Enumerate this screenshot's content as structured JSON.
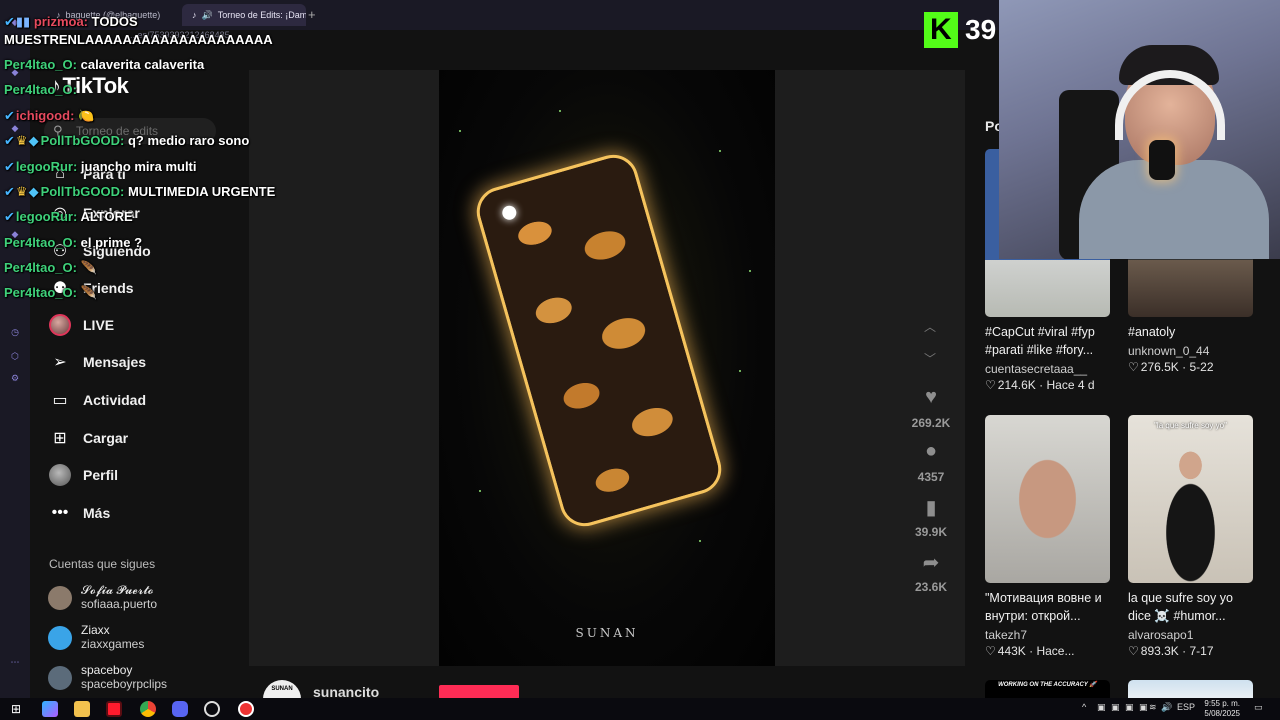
{
  "browser": {
    "tabs": [
      {
        "label": "baguette (@elbaguette)"
      },
      {
        "label": "Torneo de Edits: ¡Dam"
      }
    ],
    "new_tab": "+",
    "url_fragment": "...es/7539393212468485"
  },
  "chat": [
    {
      "user": "prizmoa:",
      "user_color": "#e64a5f",
      "message": "TODOS",
      "badges": "check-bars"
    },
    {
      "user": "",
      "user_color": "#ffffff",
      "message": "MUESTRENLAAAAAAAAAAAAAAAAAAAA",
      "badges": ""
    },
    {
      "user": "Per4ltao_O:",
      "user_color": "#3fd17a",
      "message": "calaverita calaverita",
      "badges": ""
    },
    {
      "user": "Per4ltao_O:",
      "user_color": "#3fd17a",
      "message": "",
      "badges": ""
    },
    {
      "user": "ichigood:",
      "user_color": "#e64a5f",
      "message": "",
      "emote": "🍋",
      "badges": "check"
    },
    {
      "user": "PollTbGOOD:",
      "user_color": "#3fd17a",
      "message": "q? medio raro sono",
      "badges": "check-crown-gem"
    },
    {
      "user": "legooRur:",
      "user_color": "#3fd17a",
      "message": "juancho mira multi",
      "badges": "check"
    },
    {
      "user": "PollTbGOOD:",
      "user_color": "#3fd17a",
      "message": "MULTIMEDIA URGENTE",
      "badges": "check-crown-gem"
    },
    {
      "user": "legooRur:",
      "user_color": "#3fd17a",
      "message": "ALTORE",
      "badges": "check"
    },
    {
      "user": "Per4ltao_O:",
      "user_color": "#3fd17a",
      "message": "el prime ?",
      "badges": ""
    },
    {
      "user": "Per4ltao_O:",
      "user_color": "#3fd17a",
      "message": "",
      "emote": "🪶",
      "badges": ""
    },
    {
      "user": "Per4ltao_O:",
      "user_color": "#3fd17a",
      "message": "",
      "emote": "🪶",
      "badges": ""
    }
  ],
  "tiktok": {
    "logo": "TikTok",
    "search_placeholder": "Torneo de edits",
    "nav": [
      {
        "label": "Para ti",
        "icon": "home-icon"
      },
      {
        "label": "Explorar",
        "icon": "compass-icon"
      },
      {
        "label": "Siguiendo",
        "icon": "following-icon"
      },
      {
        "label": "Friends",
        "icon": "friends-icon"
      },
      {
        "label": "LIVE",
        "icon": "live-avatar"
      },
      {
        "label": "Mensajes",
        "icon": "send-icon"
      },
      {
        "label": "Actividad",
        "icon": "activity-icon"
      },
      {
        "label": "Cargar",
        "icon": "upload-icon"
      },
      {
        "label": "Perfil",
        "icon": "profile-avatar"
      },
      {
        "label": "Más",
        "icon": "more-icon"
      }
    ],
    "following_title": "Cuentas que sigues",
    "following": [
      {
        "name": "𝓢𝓸𝓯𝓲𝓪 𝓟𝓾𝓮𝓻𝓽𝓸",
        "username": "sofiaaa.puerto",
        "color": "#8b7a6b"
      },
      {
        "name": "Ziaxx",
        "username": "ziaxxgames",
        "color": "#3aa4e8"
      },
      {
        "name": "spaceboy",
        "username": "spaceboyrpclips",
        "color": "#5b6b7a"
      }
    ]
  },
  "video": {
    "brand": "SUNAN",
    "author": "sunancito",
    "likes": "269.2K",
    "comments": "4357",
    "saves": "39.9K",
    "shares": "23.6K"
  },
  "right": {
    "title": "Po",
    "cards": [
      {
        "caption": "#CapCut #viral #fyp #parati #like #fory...",
        "author": "cuentasecretaaa__",
        "likes": "214.6K",
        "date": "Hace 4 d"
      },
      {
        "caption": "#anatoly",
        "author": "unknown_0_44",
        "likes": "276.5K",
        "date": "5-22"
      },
      {
        "caption": "\"Мотивация вовне и внутри: открой...",
        "author": "takezh7",
        "likes": "443K",
        "date": "Hace..."
      },
      {
        "caption": "la que sufre soy yo dice ☠️ #humor...",
        "author": "alvarosapo1",
        "likes": "893.3K",
        "date": "7-17"
      }
    ],
    "thumb_text_4": "\"la que sufre soy yo\" ",
    "thumb_text_6": "WORKING ON THE ACCURACY 🚀"
  },
  "stream": {
    "viewer_count": "39",
    "kick_letter": "K"
  },
  "taskbar": {
    "lang": "ESP",
    "time": "9:55 p. m.",
    "date": "5/08/2025"
  }
}
